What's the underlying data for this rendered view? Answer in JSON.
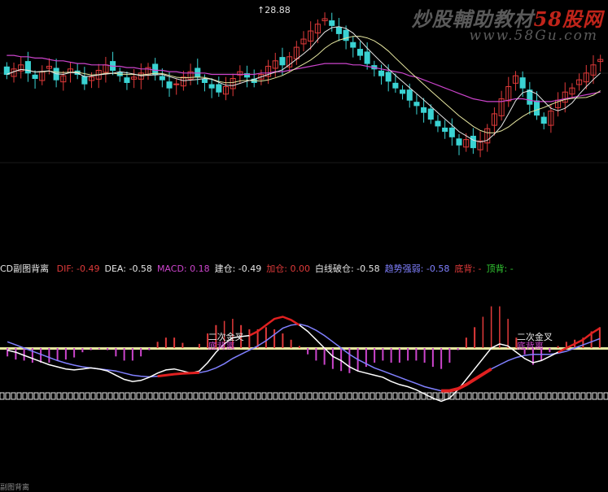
{
  "watermark": {
    "text": "炒股輔助教材",
    "brand": "58股网",
    "url": "www.58Gu.com"
  },
  "price_label": "28.88",
  "indicator_header": {
    "title": {
      "text": "CD副图背离",
      "color": "#e6e6e6"
    },
    "items": [
      {
        "label": "DIF: -0.49",
        "color": "#e03a3a"
      },
      {
        "label": "DEA: -0.58",
        "color": "#e6e6e6"
      },
      {
        "label": "MACD: 0.18",
        "color": "#cc44cc"
      },
      {
        "label": "建仓: -0.49",
        "color": "#e6e6e6"
      },
      {
        "label": "加仓: 0.00",
        "color": "#e03a3a"
      },
      {
        "label": "白线破仓: -0.58",
        "color": "#e6e6e6"
      },
      {
        "label": "趋势强弱: -0.58",
        "color": "#8080ff"
      },
      {
        "label": "底背: -",
        "color": "#e03a3a"
      },
      {
        "label": "顶背: -",
        "color": "#33cc33"
      }
    ]
  },
  "annotations": [
    {
      "text": "二次金叉",
      "color": "#e6e6e6"
    },
    {
      "text": "底背离",
      "color": "#cc44cc"
    },
    {
      "text": "二次金叉",
      "color": "#e6e6e6"
    },
    {
      "text": "底背离",
      "color": "#cc44cc"
    }
  ],
  "footer": "副图背离",
  "colors": {
    "up": "#e03a3a",
    "down": "#3ad3d3",
    "ma_short": "#e6e6e6",
    "ma_mid": "#e6e6a0",
    "ma_long": "#cc44cc",
    "dif": "#ffffff",
    "dea": "#8080ff",
    "macd_up": "#e03a3a",
    "macd_down": "#cc44cc"
  },
  "chart_data": {
    "type": "candlestick+macd",
    "price_panel": {
      "high_marker": 28.88,
      "close": [
        24.2,
        24.6,
        24.9,
        24.3,
        23.9,
        24.4,
        24.8,
        23.8,
        24.1,
        24.6,
        24.2,
        23.5,
        24.0,
        24.5,
        24.9,
        24.5,
        24.1,
        23.6,
        24.0,
        24.3,
        24.7,
        24.2,
        23.8,
        23.2,
        23.5,
        24.0,
        24.4,
        24.0,
        23.6,
        23.2,
        22.9,
        23.3,
        23.9,
        24.4,
        24.0,
        23.6,
        24.2,
        24.8,
        25.2,
        24.9,
        25.5,
        26.2,
        26.8,
        27.4,
        27.9,
        28.3,
        27.8,
        27.2,
        26.7,
        26.2,
        25.6,
        25.0,
        24.6,
        24.1,
        23.7,
        23.2,
        22.8,
        22.3,
        21.9,
        21.4,
        20.9,
        20.4,
        20.0,
        19.6,
        19.0,
        19.4,
        18.8,
        19.3,
        20.2,
        21.3,
        22.4,
        23.3,
        24.1,
        23.2,
        22.0,
        21.2,
        20.6,
        21.5,
        22.3,
        22.9,
        23.2,
        23.8,
        24.3,
        24.9,
        25.3
      ],
      "ma_long": [
        25.6,
        25.6,
        25.5,
        25.5,
        25.4,
        25.4,
        25.3,
        25.2,
        25.2,
        25.1,
        25.0,
        25.0,
        24.9,
        24.9,
        24.9,
        24.8,
        24.8,
        24.7,
        24.7,
        24.6,
        24.6,
        24.5,
        24.5,
        24.4,
        24.4,
        24.3,
        24.3,
        24.3,
        24.3,
        24.2,
        24.2,
        24.2,
        24.2,
        24.2,
        24.2,
        24.2,
        24.3,
        24.3,
        24.4,
        24.4,
        24.5,
        24.6,
        24.7,
        24.8,
        24.9,
        25.0,
        25.0,
        25.0,
        25.0,
        24.9,
        24.9,
        24.8,
        24.7,
        24.6,
        24.5,
        24.4,
        24.3,
        24.1,
        24.0,
        23.8,
        23.6,
        23.4,
        23.2,
        23.0,
        22.8,
        22.6,
        22.4,
        22.3,
        22.2,
        22.2,
        22.2,
        22.3,
        22.4,
        22.4,
        22.3,
        22.2,
        22.2,
        22.2,
        22.3,
        22.4,
        22.5,
        22.6,
        22.7,
        22.8,
        22.9
      ]
    },
    "macd_panel": {
      "dif": [
        -0.1,
        -0.2,
        -0.35,
        -0.5,
        -0.65,
        -0.8,
        -0.9,
        -1.0,
        -1.05,
        -1.0,
        -0.95,
        -1.0,
        -1.1,
        -1.3,
        -1.5,
        -1.6,
        -1.55,
        -1.4,
        -1.2,
        -1.05,
        -1.0,
        -1.1,
        -1.2,
        -1.1,
        -0.7,
        -0.2,
        0.2,
        0.5,
        0.55,
        0.6,
        0.8,
        1.1,
        1.4,
        1.5,
        1.35,
        1.1,
        0.8,
        0.4,
        0.0,
        -0.4,
        -0.6,
        -0.9,
        -1.1,
        -1.2,
        -1.3,
        -1.4,
        -1.6,
        -1.75,
        -1.85,
        -2.0,
        -2.2,
        -2.4,
        -2.55,
        -2.4,
        -2.0,
        -1.5,
        -1.0,
        -0.5,
        0.0,
        0.2,
        0.1,
        -0.2,
        -0.5,
        -0.7,
        -0.6,
        -0.4,
        -0.2,
        0.0,
        0.2,
        0.4,
        0.7,
        0.95
      ],
      "dea": [
        0.3,
        0.15,
        0.0,
        -0.15,
        -0.3,
        -0.45,
        -0.6,
        -0.72,
        -0.82,
        -0.9,
        -0.95,
        -1.0,
        -1.05,
        -1.1,
        -1.2,
        -1.3,
        -1.35,
        -1.38,
        -1.35,
        -1.3,
        -1.25,
        -1.22,
        -1.2,
        -1.18,
        -1.1,
        -0.95,
        -0.75,
        -0.5,
        -0.3,
        -0.1,
        0.1,
        0.35,
        0.65,
        0.95,
        1.1,
        1.15,
        1.05,
        0.85,
        0.6,
        0.3,
        0.0,
        -0.3,
        -0.55,
        -0.75,
        -0.95,
        -1.1,
        -1.25,
        -1.4,
        -1.55,
        -1.7,
        -1.85,
        -1.95,
        -2.05,
        -2.05,
        -1.95,
        -1.75,
        -1.5,
        -1.25,
        -1.0,
        -0.8,
        -0.6,
        -0.45,
        -0.35,
        -0.3,
        -0.3,
        -0.3,
        -0.25,
        -0.15,
        0.0,
        0.15,
        0.3,
        0.45
      ],
      "macd": [
        -0.4,
        -0.55,
        -0.6,
        -0.7,
        -0.7,
        -0.7,
        -0.6,
        -0.55,
        -0.45,
        -0.2,
        -0.1,
        -0.05,
        -0.1,
        -0.4,
        -0.6,
        -0.6,
        -0.4,
        -0.1,
        0.3,
        0.5,
        0.5,
        0.25,
        0.0,
        0.2,
        0.7,
        1.1,
        1.3,
        1.4,
        1.1,
        0.9,
        0.9,
        1.0,
        0.9,
        0.7,
        0.4,
        0.1,
        -0.3,
        -0.6,
        -0.8,
        -1.0,
        -1.1,
        -1.2,
        -1.1,
        -0.9,
        -0.7,
        -0.6,
        -0.7,
        -0.7,
        -0.6,
        -0.6,
        -0.7,
        -0.9,
        -1.0,
        -0.7,
        -0.1,
        0.5,
        1.0,
        1.5,
        2.0,
        2.0,
        1.4,
        0.5,
        -0.3,
        -0.8,
        -0.6,
        -0.2,
        0.1,
        0.3,
        0.4,
        0.5,
        0.8,
        1.0
      ]
    }
  }
}
